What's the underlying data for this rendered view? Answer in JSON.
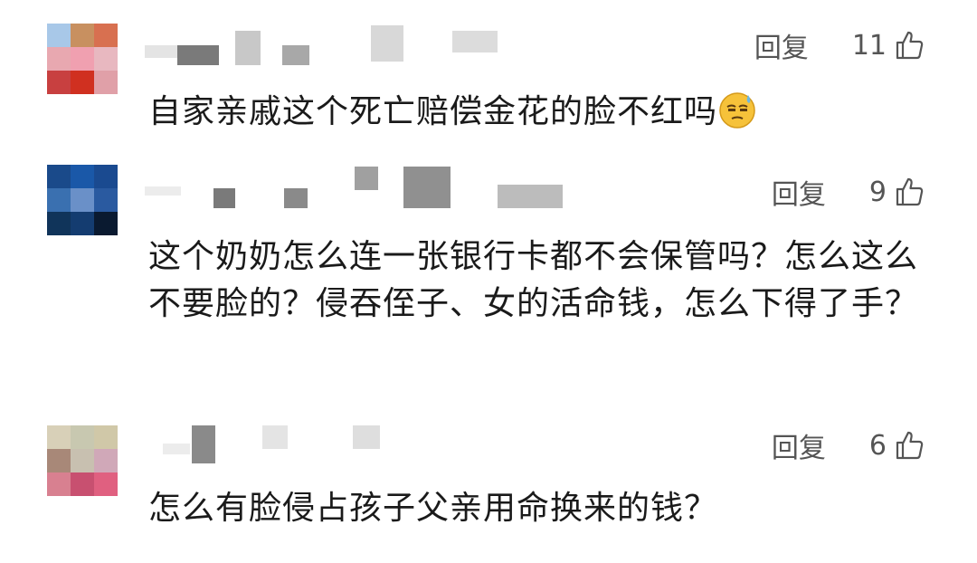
{
  "comments": [
    {
      "reply_label": "回复",
      "likes": "11",
      "text": "自家亲戚这个死亡赔偿金花的脸不红吗",
      "emoji_icon": "cold-sweat-face-icon",
      "avatar_colors": [
        "#a8c8e8",
        "#c89060",
        "#d87050",
        "#e8a8b0",
        "#f0a0b0",
        "#e8b8c0",
        "#c84040",
        "#d03020",
        "#e0a0a8"
      ]
    },
    {
      "reply_label": "回复",
      "likes": "9",
      "text": "这个奶奶怎么连一张银行卡都不会保管吗？怎么这么不要脸的？侵吞侄子、女的活命钱，怎么下得了手？",
      "avatar_colors": [
        "#1a4a8a",
        "#1a58a8",
        "#1a4a90",
        "#3a70b0",
        "#6a90c8",
        "#2a5aa0",
        "#10345a",
        "#143c70",
        "#0a1a30"
      ]
    },
    {
      "reply_label": "回复",
      "likes": "6",
      "text": "怎么有脸侵占孩子父亲用命换来的钱？",
      "avatar_colors": [
        "#d8d0b8",
        "#c8c8b0",
        "#d0c8a8",
        "#a88878",
        "#c8c0b0",
        "#d0a8b8",
        "#d88090",
        "#c85070",
        "#e06080"
      ]
    }
  ]
}
